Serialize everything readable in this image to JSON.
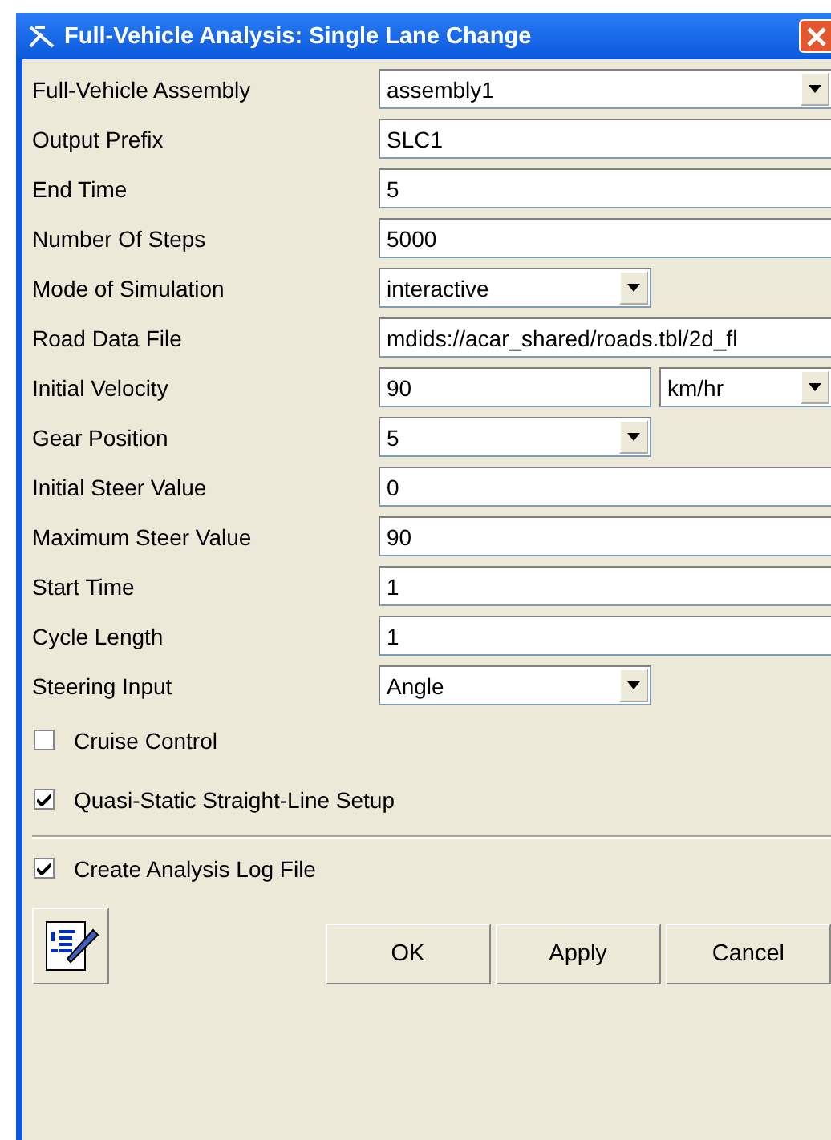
{
  "window": {
    "title": "Full-Vehicle Analysis: Single Lane Change"
  },
  "fields": [
    {
      "label": "Full-Vehicle Assembly",
      "kind": "combo",
      "value": "assembly1"
    },
    {
      "label": "Output Prefix",
      "kind": "text",
      "value": "SLC1"
    },
    {
      "label": "End Time",
      "kind": "text",
      "value": "5"
    },
    {
      "label": "Number Of Steps",
      "kind": "text",
      "value": "5000"
    },
    {
      "label": "Mode of Simulation",
      "kind": "short-combo",
      "value": "interactive"
    },
    {
      "label": "Road Data File",
      "kind": "text",
      "value": "mdids://acar_shared/roads.tbl/2d_fl"
    },
    {
      "label": "Initial Velocity",
      "kind": "text-unit",
      "value": "90",
      "unit": "km/hr"
    },
    {
      "label": "Gear Position",
      "kind": "short-combo",
      "value": "5"
    },
    {
      "label": "Initial Steer Value",
      "kind": "text",
      "value": "0"
    },
    {
      "label": "Maximum Steer Value",
      "kind": "text",
      "value": "90"
    },
    {
      "label": "Start Time",
      "kind": "text",
      "value": "1"
    },
    {
      "label": "Cycle Length",
      "kind": "text",
      "value": "1"
    },
    {
      "label": "Steering Input",
      "kind": "short-combo",
      "value": "Angle"
    }
  ],
  "options": [
    {
      "label": "Cruise Control",
      "checked": false
    },
    {
      "label": "Quasi-Static Straight-Line Setup",
      "checked": true
    }
  ],
  "log_option": {
    "label": "Create Analysis Log File",
    "checked": true
  },
  "buttons": [
    "OK",
    "Apply",
    "Cancel"
  ]
}
